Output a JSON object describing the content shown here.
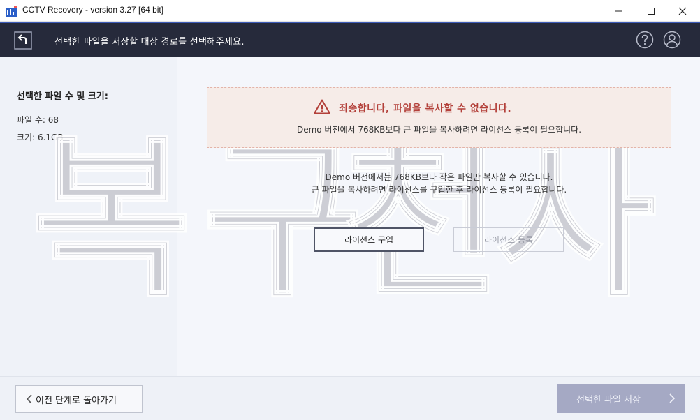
{
  "window": {
    "title": "CCTV Recovery - version 3.27 [64 bit]",
    "controls": [
      "minimize-icon",
      "maximize-icon",
      "close-icon"
    ]
  },
  "header": {
    "instruction": "선택한 파일을 저장할 대상 경로를 선택해주세요.",
    "icons": [
      "back-icon",
      "help-icon",
      "user-icon"
    ]
  },
  "sidebar": {
    "title": "선택한 파일 수 및 크기:",
    "file_count": "파일 수: 68",
    "file_size": "크기: 6.1GB"
  },
  "alert": {
    "icon": "warning-icon",
    "title": "죄송합니다, 파일을 복사할 수 없습니다.",
    "message": "Demo 버전에서 768KB보다 큰 파일을 복사하려면 라이선스 등록이 필요합니다."
  },
  "info": {
    "line1": "Demo 버전에서는 768KB보다 작은 파일만 복사할 수 있습니다.",
    "line2": "큰 파일을 복사하려면 라이선스를 구입한 후 라이선스 등록이 필요합니다."
  },
  "buttons": {
    "buy_license": "라이선스 구입",
    "register_license": "라이선스 등록"
  },
  "footer": {
    "back": "이전 단계로 돌아가기",
    "save": "선택한 파일 저장"
  },
  "watermark": [
    "복",
    "구",
    "천",
    "사"
  ],
  "colors": {
    "header_bg": "#262a3b",
    "accent": "#3d5cb8",
    "alert_title": "#b3403a",
    "save_button": "#a5a9c4"
  }
}
